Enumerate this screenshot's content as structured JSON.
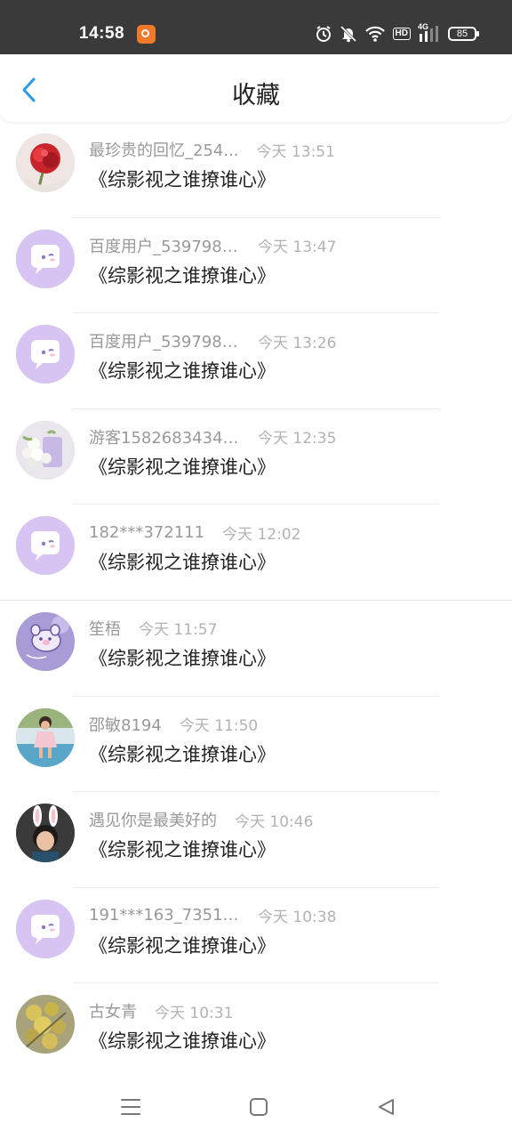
{
  "status_bar": {
    "time": "14:58",
    "battery": "85",
    "network": "4G",
    "hd": "HD"
  },
  "header": {
    "title": "收藏"
  },
  "items": [
    {
      "name": "最珍贵的回忆_254...",
      "time": "今天 13:51",
      "title": "《综影视之谁撩谁心》",
      "avatar": "red-flower-photo"
    },
    {
      "name": "百度用户_5397989...",
      "time": "今天 13:47",
      "title": "《综影视之谁撩谁心》",
      "avatar": "default-chat"
    },
    {
      "name": "百度用户_5397989...",
      "time": "今天 13:26",
      "title": "《综影视之谁撩谁心》",
      "avatar": "default-chat"
    },
    {
      "name": "游客15826834349...",
      "time": "今天 12:35",
      "title": "《综影视之谁撩谁心》",
      "avatar": "white-flowers-photo"
    },
    {
      "name": "182***372111",
      "time": "今天 12:02",
      "title": "《综影视之谁撩谁心》",
      "avatar": "default-chat"
    },
    {
      "name": "笙梧",
      "time": "今天 11:57",
      "title": "《综影视之谁撩谁心》",
      "avatar": "cartoon-purple"
    },
    {
      "name": "邵敏8194",
      "time": "今天 11:50",
      "title": "《综影视之谁撩谁心》",
      "avatar": "child-photo"
    },
    {
      "name": "遇见你是最美好的",
      "time": "今天 10:46",
      "title": "《综影视之谁撩谁心》",
      "avatar": "bunny-ears-photo"
    },
    {
      "name": "191***163_73518...",
      "time": "今天 10:38",
      "title": "《综影视之谁撩谁心》",
      "avatar": "default-chat"
    },
    {
      "name": "古女青",
      "time": "今天 10:31",
      "title": "《综影视之谁撩谁心》",
      "avatar": "yellow-flowers-photo"
    }
  ],
  "colors": {
    "accent": "#2b9be8",
    "avatar_default": "#d7c4f3"
  }
}
